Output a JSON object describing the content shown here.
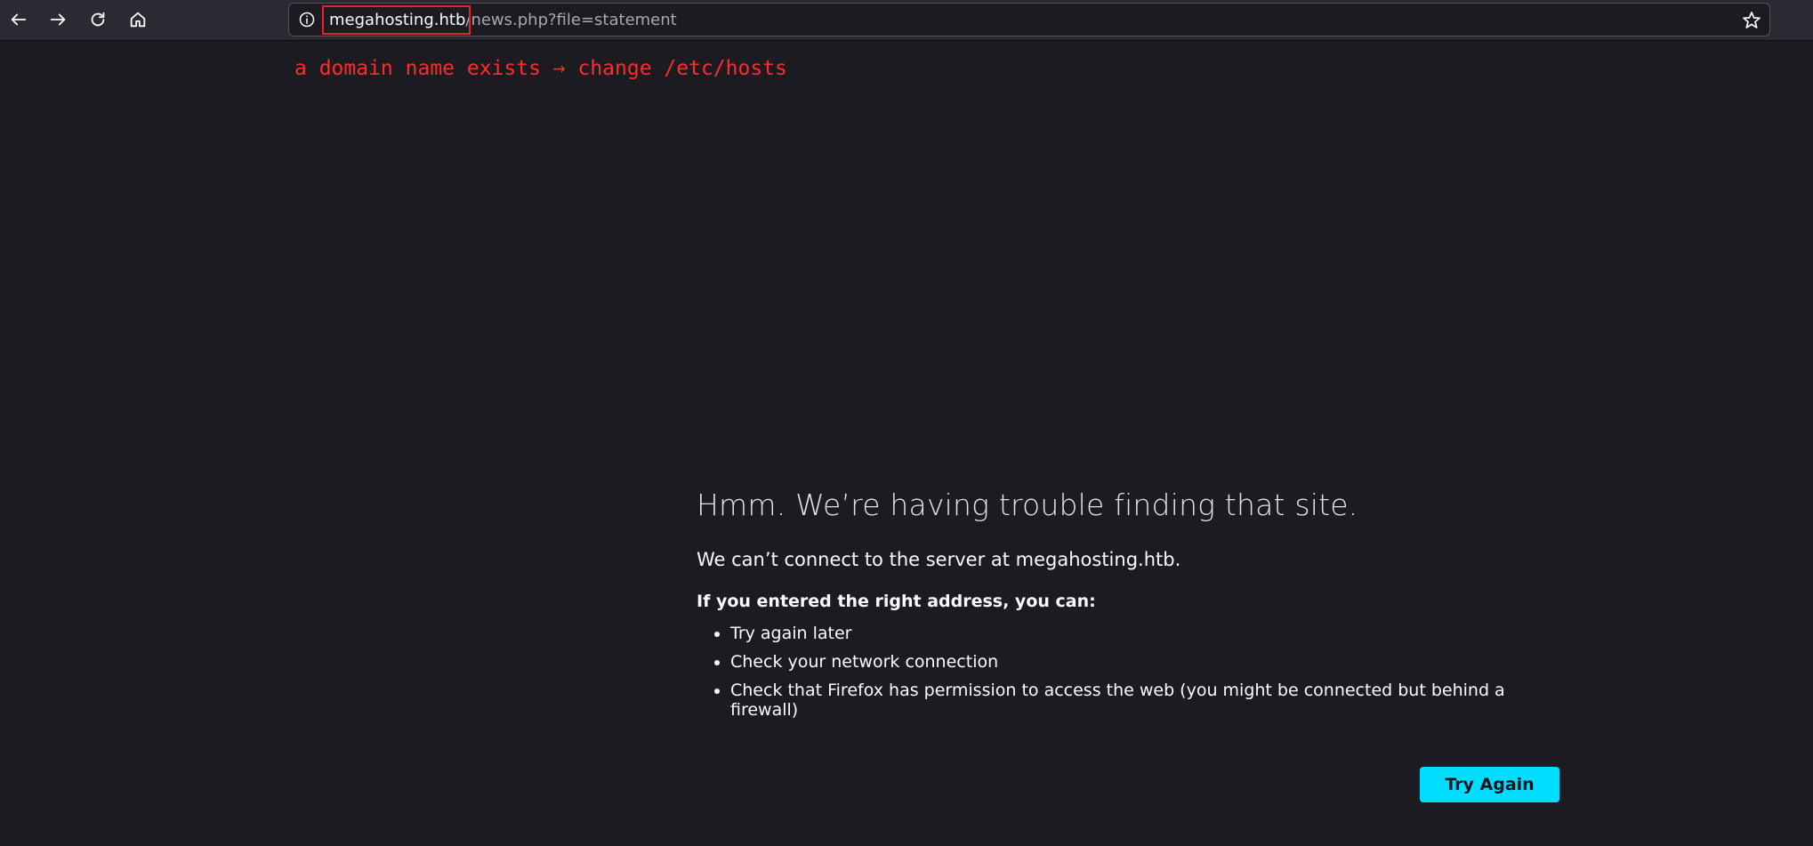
{
  "toolbar": {
    "icons": {
      "back": "back-arrow-icon",
      "forward": "forward-arrow-icon",
      "reload": "reload-icon",
      "home": "home-icon",
      "info": "info-icon",
      "bookmark": "star-icon"
    }
  },
  "urlbar": {
    "domain": "megahosting.htb",
    "path": "/news.php?file=statement"
  },
  "annotation": {
    "text": "a domain name exists → change /etc/hosts",
    "color": "#ff2b2b"
  },
  "error": {
    "title": "Hmm. We’re having trouble finding that site.",
    "description": "We can’t connect to the server at megahosting.htb.",
    "subheading": "If you entered the right address, you can:",
    "suggestions": [
      "Try again later",
      "Check your network connection",
      "Check that Firefox has permission to access the web (you might be connected but behind a firewall)"
    ],
    "button_label": "Try Again"
  },
  "colors": {
    "page_background": "#1c1b22",
    "toolbar_background": "#2b2a33",
    "accent": "#00ddff",
    "highlight_box": "#e3232c"
  }
}
